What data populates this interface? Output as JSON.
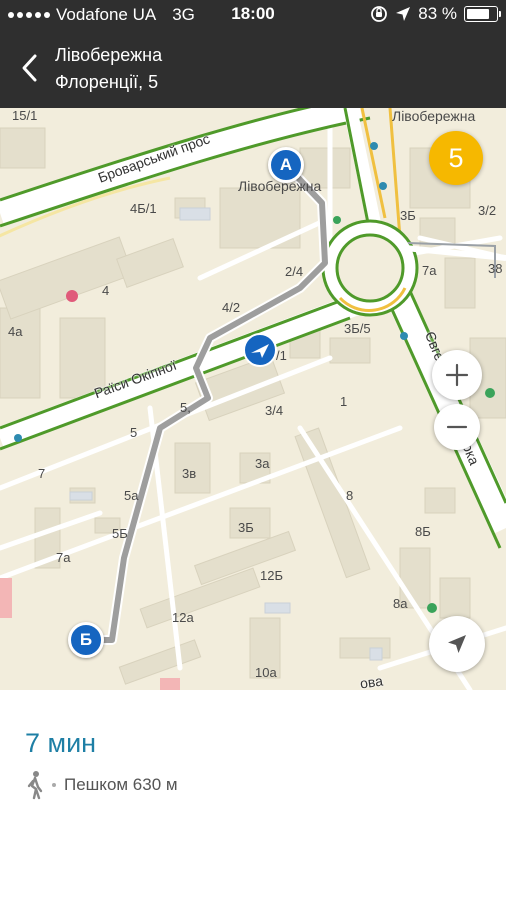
{
  "status_bar": {
    "carrier": "Vodafone UA",
    "network": "3G",
    "time": "18:00",
    "battery_percent": "83 %",
    "battery_level": 0.83,
    "icons": [
      "signal-dots-icon",
      "orientation-lock-icon",
      "location-arrow-icon",
      "battery-icon"
    ]
  },
  "header": {
    "title_line1": "Лівобережна",
    "title_line2": "Флоренції, 5",
    "back_icon": "chevron-left-icon"
  },
  "map": {
    "streets": {
      "brovarskyi": "Броварський прос",
      "raisy_okipnoi": "Раїси Окіпної",
      "yevhena": "Євге",
      "ska": "ока",
      "bottom_street": "ова"
    },
    "places": {
      "livoberezhna_1": "Лівобережна",
      "livoberezhna_2": "Лівобережна"
    },
    "house_numbers": {
      "n15_1": "15/1",
      "n4b_1": "4Б/1",
      "n4": "4",
      "n4a": "4а",
      "n2_4": "2/4",
      "n4_2": "4/2",
      "n3b_5": "3Б/5",
      "n1_slash": "/1",
      "n3_4": "3/4",
      "n1": "1",
      "n5a_top": "5,",
      "n5": "5",
      "n7": "7",
      "n3v": "3в",
      "n3a": "3а",
      "n5a": "5а",
      "n5b": "5Б",
      "n3b": "3Б",
      "n7a": "7а",
      "n12b": "12Б",
      "n12a": "12а",
      "n10a": "10а",
      "n8": "8",
      "n8b": "8Б",
      "n8a": "8а",
      "n3b_top": "3Б",
      "n3_2": "3/2",
      "n7a_right": "7а",
      "n38": "38"
    },
    "traffic_level": "5",
    "traffic_color": "#f6b800",
    "route_color": "#9e9e9e",
    "pin_color": "#1565c0",
    "pin_a_label": "A",
    "pin_b_label": "Б",
    "controls": {
      "zoom_in_icon": "plus-icon",
      "zoom_out_icon": "minus-icon",
      "locate_icon": "navigation-arrow-icon"
    }
  },
  "route_summary": {
    "duration": "7 мин",
    "mode_icon": "walking-person-icon",
    "mode_text": "Пешком 630 м",
    "accent_color": "#1e7fa5"
  }
}
